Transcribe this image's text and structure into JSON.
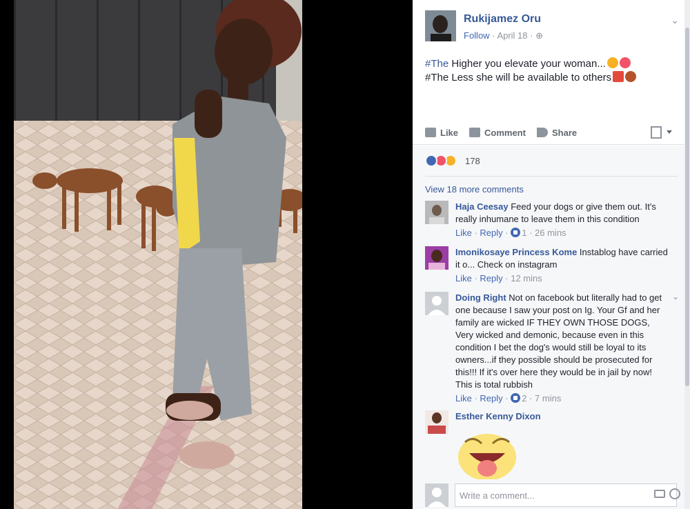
{
  "post": {
    "author": "Rukijamez Oru",
    "follow_label": "Follow",
    "date": "April 18",
    "text_line1_hash": "#The",
    "text_line1": " Higher you elevate your woman...",
    "text_line2": "#The Less she will be available to others"
  },
  "actions": {
    "like": "Like",
    "comment": "Comment",
    "share": "Share"
  },
  "reactions": {
    "types": [
      "like",
      "love",
      "haha"
    ],
    "count": "178"
  },
  "view_more": "View 18 more comments",
  "comments": [
    {
      "name": "Haja Ceesay",
      "text": " Feed your dogs or give them out. It's really inhumane to leave them in this condition",
      "like": "Like",
      "reply": "Reply",
      "likes": "1",
      "time": "26 mins"
    },
    {
      "name": "Imonikosaye Princess Kome",
      "text": " Instablog have carried it o... Check on instagram",
      "like": "Like",
      "reply": "Reply",
      "time": "12 mins"
    },
    {
      "name": "Doing Right",
      "text": " Not on facebook but literally had to get one because I saw your post on Ig. Your Gf and her family are wicked IF THEY OWN THOSE DOGS, Very wicked and demonic, because even in this condition I bet the dog's would still be loyal to its owners...if they possible should be prosecuted for this!!! If it's over here they would be in jail by now! This is total rubbish",
      "like": "Like",
      "reply": "Reply",
      "likes": "2",
      "time": "7 mins"
    },
    {
      "name": "Esther Kenny Dixon"
    }
  ],
  "composer": {
    "placeholder": "Write a comment..."
  },
  "colors": {
    "link": "#365899",
    "like_blue": "#4267b2",
    "love_red": "#f25268",
    "haha_yellow": "#f7b125"
  }
}
